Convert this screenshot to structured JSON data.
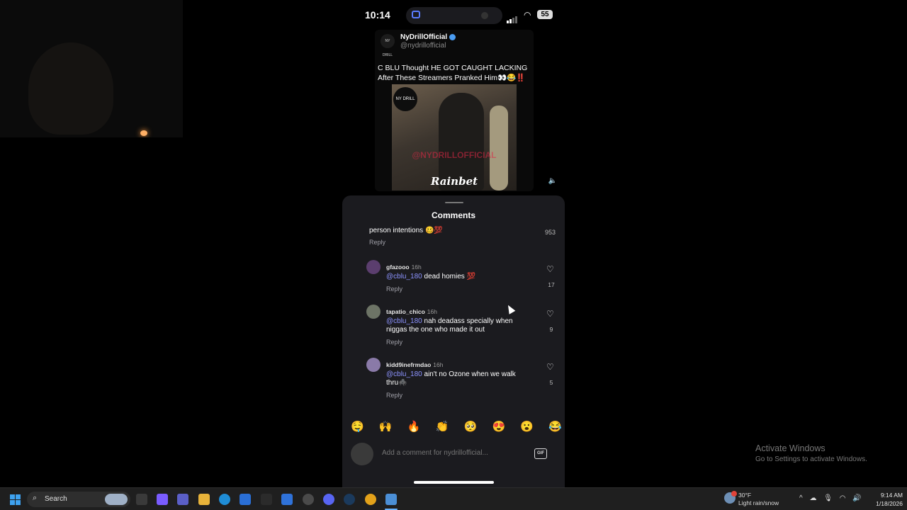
{
  "status_bar": {
    "time": "10:14",
    "battery": "55"
  },
  "tweet": {
    "name": "NyDrillOfficial",
    "handle": "@nydrillofficial",
    "avatar_text": "NY DRILL",
    "text": "C BLU Thought HE GOT CAUGHT LACKING After These Streamers Pranked Him👀😂‼️",
    "video_watermark": "@NYDRILLOFFICIAL",
    "video_brand": "Rainbet"
  },
  "comments_sheet": {
    "title": "Comments",
    "first_comment": {
      "text": "person intentions 🥴💯",
      "count": "953",
      "reply": "Reply"
    },
    "comments": [
      {
        "user": "gfazooo",
        "time": "16h",
        "mention": "@cblu_180",
        "text": " dead homies 💯",
        "reply": "Reply",
        "likes": "17",
        "avatar_color": "#5b3e6e"
      },
      {
        "user": "tapatio_chico",
        "time": "16h",
        "mention": "@cblu_180",
        "text": " nah deadass specially when niggas the one who made it out",
        "reply": "Reply",
        "likes": "9",
        "avatar_color": "#6d7466"
      },
      {
        "user": "kidd9inefrmdao",
        "time": "16h",
        "mention": "@cblu_180",
        "text": " ain't no Ozone when we walk thru🕷️",
        "reply": "Reply",
        "likes": "5",
        "avatar_color": "#8a7aa8"
      }
    ],
    "emojis": [
      "🤤",
      "🙌",
      "🔥",
      "👏",
      "🥺",
      "😍",
      "😮",
      "😂"
    ],
    "composer_placeholder": "Add a comment for nydrillofficial...",
    "gif_label": "GIF"
  },
  "activate_windows": {
    "title": "Activate Windows",
    "subtitle": "Go to Settings to activate Windows."
  },
  "taskbar": {
    "search_label": "Search",
    "weather_temp": "30°F",
    "weather_condition": "Light rain/snow",
    "time": "9:14 AM",
    "date": "1/18/2026",
    "apps": [
      {
        "name": "task-view-icon",
        "color": "#3a3a3a"
      },
      {
        "name": "copilot-icon",
        "color": "#7a5cff"
      },
      {
        "name": "teams-icon",
        "color": "#5b5fc7"
      },
      {
        "name": "file-explorer-icon",
        "color": "#e8b33a"
      },
      {
        "name": "edge-icon",
        "color": "#1f8dd6"
      },
      {
        "name": "store-icon",
        "color": "#2a6fd6"
      },
      {
        "name": "epic-games-icon",
        "color": "#2b2b2b"
      },
      {
        "name": "blue-app-icon",
        "color": "#2f72d9"
      },
      {
        "name": "rockstar-icon",
        "color": "#4a4a4a"
      },
      {
        "name": "discord-icon",
        "color": "#5865f2"
      },
      {
        "name": "steam-icon",
        "color": "#1b3a5c"
      },
      {
        "name": "chrome-icon",
        "color": "#e3a21a"
      },
      {
        "name": "phone-link-icon",
        "color": "#4b8fd6"
      }
    ]
  }
}
